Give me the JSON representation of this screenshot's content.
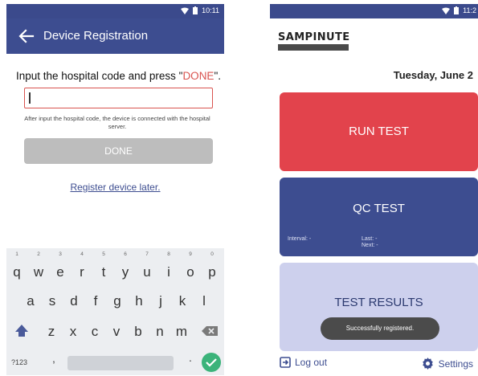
{
  "left": {
    "status_time": "10:11",
    "title": "Device Registration",
    "instruction_prefix": "Input the hospital code and press \"",
    "instruction_done": "DONE",
    "instruction_suffix": "\".",
    "hospital_code_value": "",
    "hint": "After input the hospital code, the device is connected with the hospital server.",
    "done_label": "DONE",
    "register_later": "Register device later.",
    "keyboard": {
      "row1": [
        {
          "key": "q",
          "sup": "1"
        },
        {
          "key": "w",
          "sup": "2"
        },
        {
          "key": "e",
          "sup": "3"
        },
        {
          "key": "r",
          "sup": "4"
        },
        {
          "key": "t",
          "sup": "5"
        },
        {
          "key": "y",
          "sup": "6"
        },
        {
          "key": "u",
          "sup": "7"
        },
        {
          "key": "i",
          "sup": "8"
        },
        {
          "key": "o",
          "sup": "9"
        },
        {
          "key": "p",
          "sup": "0"
        }
      ],
      "row2": [
        "a",
        "s",
        "d",
        "f",
        "g",
        "h",
        "j",
        "k",
        "l"
      ],
      "row3": [
        "z",
        "x",
        "c",
        "v",
        "b",
        "n",
        "m"
      ],
      "symbols_label": "?123",
      "comma": ",",
      "period": "."
    }
  },
  "right": {
    "status_time": "11:2",
    "brand": "SAMPINUTE",
    "date": "Tuesday, June 2",
    "run_test": "RUN TEST",
    "qc_test": "QC TEST",
    "qc_interval": "Interval: -",
    "qc_last": "Last: -",
    "qc_next": "Next: -",
    "test_results": "TEST RESULTS",
    "toast": "Successfully registered.",
    "logout": "Log out",
    "settings": "Settings"
  },
  "colors": {
    "primary": "#3d4d90",
    "run": "#e2434c",
    "results": "#cdd0ed",
    "accent_red": "#d9534f",
    "enter_green": "#3bb37a"
  },
  "icons": {
    "back": "arrow-left-icon",
    "wifi": "wifi-icon",
    "battery": "battery-icon",
    "shift": "shift-icon",
    "backspace": "backspace-icon",
    "enter": "check-icon",
    "logout": "logout-icon",
    "settings": "gear-icon"
  }
}
